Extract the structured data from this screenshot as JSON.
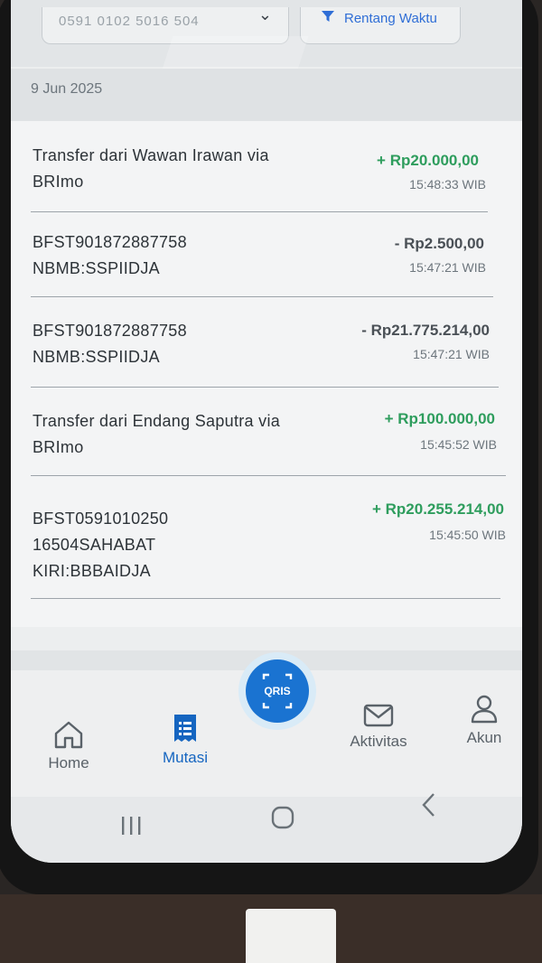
{
  "header": {
    "account_number": "0591 0102 5016 504",
    "date_filter_label": "Rentang Waktu",
    "date_group": "9 Jun 2025"
  },
  "transactions": [
    {
      "description": "Transfer dari Wawan Irawan via BRImo",
      "amount": "+ Rp20.000,00",
      "type": "credit",
      "time": "15:48:33 WIB"
    },
    {
      "description": "BFST901872887758 NBMB:SSPIIDJA",
      "amount": "- Rp2.500,00",
      "type": "debit",
      "time": "15:47:21 WIB"
    },
    {
      "description": "BFST901872887758 NBMB:SSPIIDJA",
      "amount": "- Rp21.775.214,00",
      "type": "debit",
      "time": "15:47:21 WIB"
    },
    {
      "description": "Transfer dari Endang Saputra via BRImo",
      "amount": "+ Rp100.000,00",
      "type": "credit",
      "time": "15:45:52 WIB"
    },
    {
      "description": "BFST0591010250 16504SAHABAT KIRI:BBBAIDJA",
      "amount": "+ Rp20.255.214,00",
      "type": "credit",
      "time": "15:45:50 WIB"
    }
  ],
  "bottom_nav": {
    "home": "Home",
    "mutasi": "Mutasi",
    "qris": "QRIS",
    "aktivitas": "Aktivitas",
    "akun": "Akun"
  },
  "colors": {
    "credit": "#2e9d5d",
    "debit": "#4a5056",
    "accent": "#1565c0",
    "qris_button": "#1a73d1"
  },
  "icons": [
    "chevron-down-icon",
    "filter-icon",
    "home-icon",
    "mutasi-icon",
    "qris-icon",
    "mail-icon",
    "user-icon",
    "recents-icon",
    "home-circle-icon",
    "back-icon"
  ]
}
